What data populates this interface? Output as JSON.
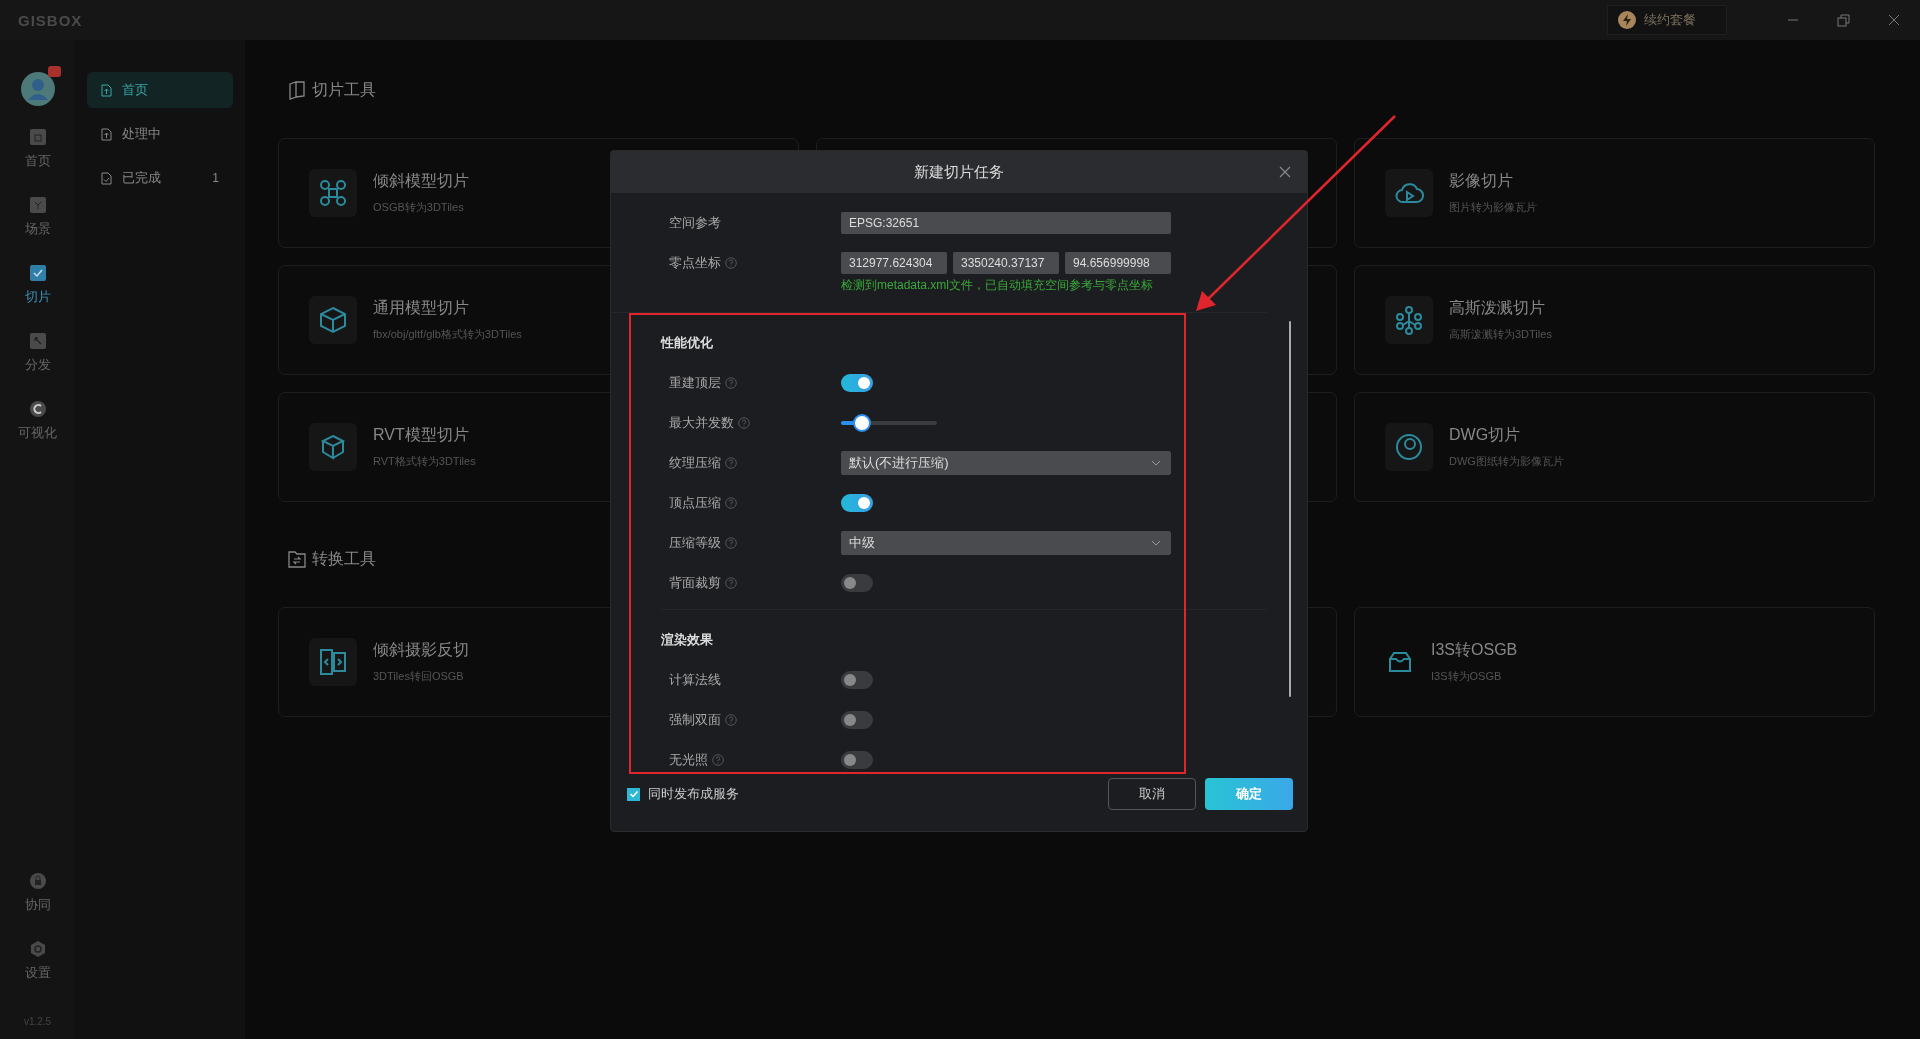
{
  "title_bar": {
    "logo": "GISBOX",
    "renew_button": "续约套餐"
  },
  "rail": {
    "items": [
      {
        "label": "首页",
        "selected": false
      },
      {
        "label": "场景",
        "selected": false
      },
      {
        "label": "切片",
        "selected": true
      },
      {
        "label": "分发",
        "selected": false
      },
      {
        "label": "可视化",
        "selected": false
      }
    ],
    "bottom_items": [
      {
        "label": "协同"
      },
      {
        "label": "设置"
      }
    ],
    "version": "v1.2.5"
  },
  "subnav": [
    {
      "label": "首页",
      "selected": true
    },
    {
      "label": "处理中",
      "selected": false
    },
    {
      "label": "已完成",
      "selected": false,
      "count": "1"
    }
  ],
  "sections": [
    {
      "title": "切片工具",
      "rows": [
        {
          "left": {
            "title": "倾斜模型切片",
            "subtitle": "OSGB转为3DTiles"
          },
          "right": {
            "title": "影像切片",
            "subtitle": "图片转为影像瓦片"
          }
        },
        {
          "left": {
            "title": "通用模型切片",
            "subtitle": "fbx/obj/gltf/glb格式转为3DTiles"
          },
          "right": {
            "title": "高斯泼溅切片",
            "subtitle": "高斯泼溅转为3DTiles"
          }
        },
        {
          "left": {
            "title": "RVT模型切片",
            "subtitle": "RVT格式转为3DTiles"
          },
          "right": {
            "title": "DWG切片",
            "subtitle": "DWG图纸转为影像瓦片"
          }
        }
      ]
    },
    {
      "title": "转换工具",
      "rows": [
        {
          "left": {
            "title": "倾斜摄影反切",
            "subtitle": "3DTiles转回OSGB"
          },
          "right": {
            "title": "I3S转OSGB",
            "subtitle": "I3S转为OSGB"
          }
        }
      ]
    }
  ],
  "dialog": {
    "title": "新建切片任务",
    "spatial_ref": {
      "label": "空间参考",
      "value": "EPSG:32651"
    },
    "origin": {
      "label": "零点坐标",
      "values": [
        "312977.624304",
        "3350240.37137",
        "94.656999998"
      ],
      "hint": "检测到metadata.xml文件，已自动填充空间参考与零点坐标"
    },
    "sections": [
      {
        "title": "性能优化",
        "items": [
          {
            "kind": "switch",
            "label": "重建顶层",
            "help": true,
            "on": true
          },
          {
            "kind": "slider",
            "label": "最大并发数",
            "help": true,
            "level": 0.22
          },
          {
            "kind": "select",
            "label": "纹理压缩",
            "help": true,
            "value": "默认(不进行压缩)"
          },
          {
            "kind": "switch",
            "label": "顶点压缩",
            "help": true,
            "on": true
          },
          {
            "kind": "select",
            "label": "压缩等级",
            "help": true,
            "value": "中级"
          },
          {
            "kind": "switch",
            "label": "背面裁剪",
            "help": true,
            "on": false
          }
        ]
      },
      {
        "title": "渲染效果",
        "items": [
          {
            "kind": "switch",
            "label": "计算法线",
            "help": false,
            "on": false
          },
          {
            "kind": "switch",
            "label": "强制双面",
            "help": true,
            "on": false
          },
          {
            "kind": "switch",
            "label": "无光照",
            "help": true,
            "on": false
          }
        ]
      }
    ],
    "publish": {
      "label": "同时发布成服务",
      "checked": true
    },
    "buttons": [
      {
        "kind": "secondary",
        "label": "取消"
      },
      {
        "kind": "primary",
        "label": "确定"
      }
    ]
  }
}
